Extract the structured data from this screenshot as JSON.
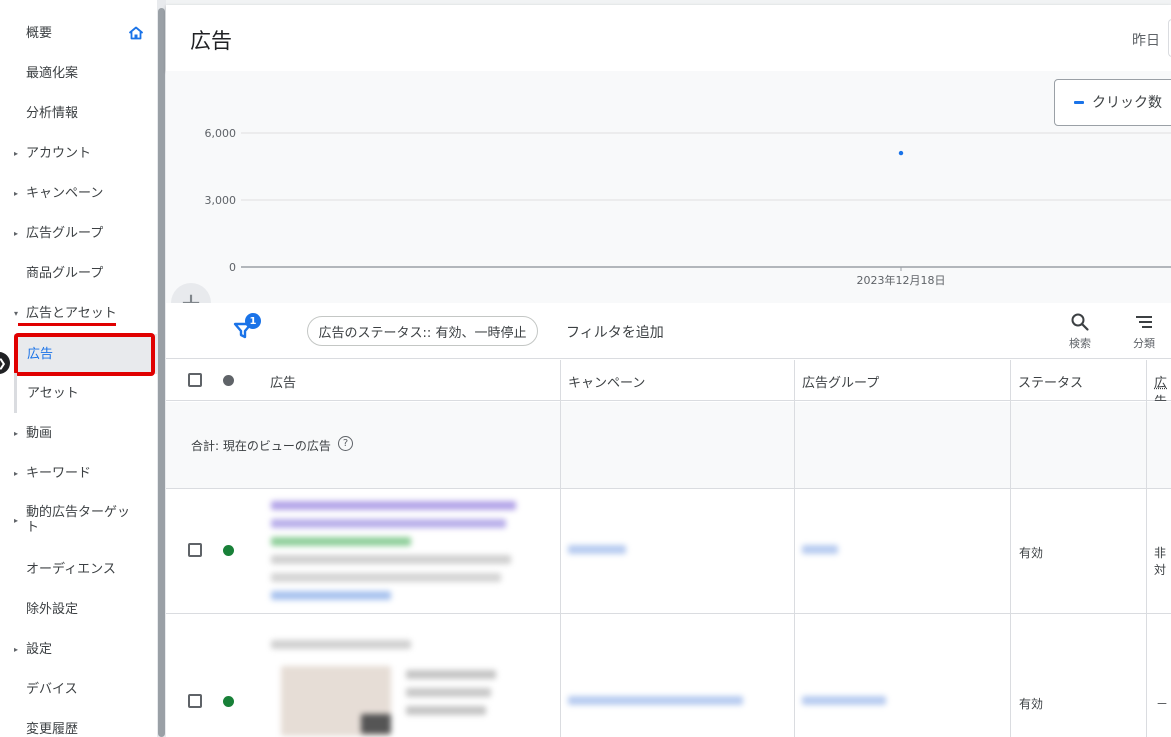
{
  "sidebar": {
    "items": [
      {
        "label": "概要",
        "arrow": ""
      },
      {
        "label": "最適化案",
        "arrow": ""
      },
      {
        "label": "分析情報",
        "arrow": ""
      },
      {
        "label": "アカウント",
        "arrow": "▸"
      },
      {
        "label": "キャンペーン",
        "arrow": "▸"
      },
      {
        "label": "広告グループ",
        "arrow": "▸"
      },
      {
        "label": "商品グループ",
        "arrow": ""
      },
      {
        "label": "広告とアセット",
        "arrow": "▾"
      },
      {
        "label": "広告",
        "arrow": ""
      },
      {
        "label": "アセット",
        "arrow": ""
      },
      {
        "label": "動画",
        "arrow": "▸"
      },
      {
        "label": "キーワード",
        "arrow": "▸"
      },
      {
        "label": "動的広告ターゲット",
        "arrow": "▸"
      },
      {
        "label": "オーディエンス",
        "arrow": ""
      },
      {
        "label": "除外設定",
        "arrow": ""
      },
      {
        "label": "設定",
        "arrow": "▸"
      },
      {
        "label": "デバイス",
        "arrow": ""
      },
      {
        "label": "変更履歴",
        "arrow": ""
      }
    ],
    "collapse_glyph": "❯"
  },
  "header": {
    "title": "広告",
    "date_range": "昨日"
  },
  "chart": {
    "metric_label": "クリック数",
    "metric_color": "#1a73e8",
    "add_glyph": "+"
  },
  "chart_data": {
    "type": "scatter",
    "title": "",
    "x": [
      "2023年12月18日"
    ],
    "series": [
      {
        "name": "クリック数",
        "values": [
          5100
        ]
      }
    ],
    "y_ticks": [
      "6,000",
      "3,000",
      "0"
    ],
    "ylim": [
      0,
      6000
    ],
    "x_tick_label": "2023年12月18日",
    "grid": true
  },
  "filterbar": {
    "badge": "1",
    "chip": "広告のステータス:: 有効、一時停止",
    "add_filter": "フィルタを追加",
    "search_label": "検索",
    "segment_label": "分類"
  },
  "table": {
    "columns": [
      "広告",
      "キャンペーン",
      "広告グループ",
      "ステータス",
      "広告"
    ],
    "total_label": "合計: 現在のビューの広告",
    "help_glyph": "?",
    "rows": [
      {
        "status": "有効",
        "extra": "非対",
        "dot_color": "#188038"
      },
      {
        "status": "有効",
        "extra": "－",
        "dot_color": "#188038"
      }
    ]
  }
}
